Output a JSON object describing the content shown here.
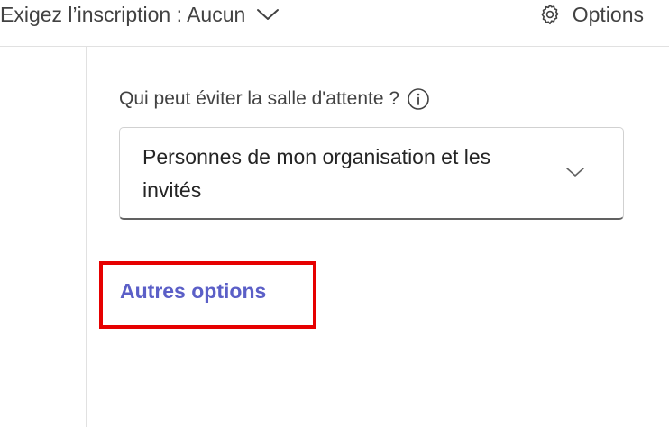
{
  "topbar": {
    "registration_label": "Exigez l’inscription : Aucun",
    "registration_chevron_icon": "chevron-down-icon",
    "options_label": "Options",
    "options_icon": "gear-icon"
  },
  "lobby": {
    "question": "Qui peut éviter la salle d'attente ?",
    "info_icon": "info-icon",
    "selected_value": "Personnes de mon organisation et les invités",
    "dropdown_icon": "chevron-down-icon"
  },
  "more_options": {
    "label": "Autres options"
  },
  "colors": {
    "link": "#5b5fc7",
    "highlight": "#e60000",
    "divider": "#e1e1e1",
    "text": "#424242"
  }
}
